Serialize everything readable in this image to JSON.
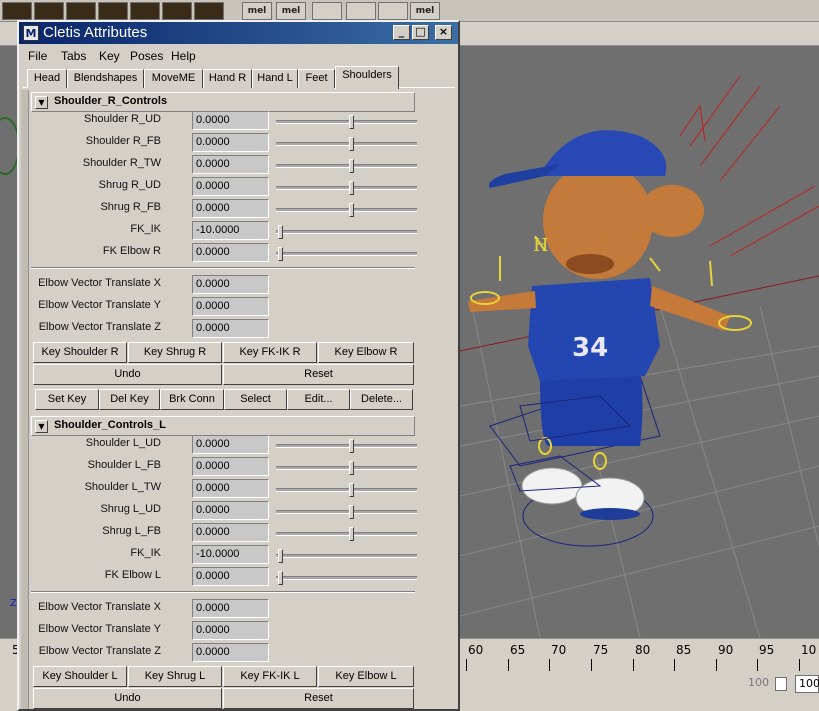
{
  "window": {
    "title": "Cletis Attributes",
    "minimize": "_",
    "maximize": "□",
    "close": "×"
  },
  "menu": [
    "File",
    "Tabs",
    "Key",
    "Poses",
    "Help"
  ],
  "tabs": [
    "Head",
    "Blendshapes",
    "MoveME",
    "Hand R",
    "Hand L",
    "Feet",
    "Shoulders"
  ],
  "active_tab": "Shoulders",
  "sections": {
    "right": {
      "title": "Shoulder_R_Controls",
      "sliders": [
        {
          "label": "Shoulder R_UD",
          "value": "0.0000",
          "pos": 0.5
        },
        {
          "label": "Shoulder R_FB",
          "value": "0.0000",
          "pos": 0.5
        },
        {
          "label": "Shoulder R_TW",
          "value": "0.0000",
          "pos": 0.5
        },
        {
          "label": "Shrug R_UD",
          "value": "0.0000",
          "pos": 0.5
        },
        {
          "label": "Shrug R_FB",
          "value": "0.0000",
          "pos": 0.5
        },
        {
          "label": "FK_IK",
          "value": "-10.0000",
          "pos": 0.0
        },
        {
          "label": "FK Elbow R",
          "value": "0.0000",
          "pos": 0.0
        }
      ],
      "vectors": [
        {
          "label": "Elbow Vector Translate X",
          "value": "0.0000"
        },
        {
          "label": "Elbow Vector Translate Y",
          "value": "0.0000"
        },
        {
          "label": "Elbow Vector Translate Z",
          "value": "0.0000"
        }
      ],
      "key_buttons": [
        "Key Shoulder R",
        "Key Shrug R",
        "Key FK-IK R",
        "Key Elbow R"
      ],
      "undo": "Undo",
      "reset": "Reset"
    },
    "toolbar": [
      "Set Key",
      "Del Key",
      "Brk Conn",
      "Select",
      "Edit...",
      "Delete..."
    ],
    "left": {
      "title": "Shoulder_Controls_L",
      "sliders": [
        {
          "label": "Shoulder L_UD",
          "value": "0.0000",
          "pos": 0.5
        },
        {
          "label": "Shoulder L_FB",
          "value": "0.0000",
          "pos": 0.5
        },
        {
          "label": "Shoulder L_TW",
          "value": "0.0000",
          "pos": 0.5
        },
        {
          "label": "Shrug L_UD",
          "value": "0.0000",
          "pos": 0.5
        },
        {
          "label": "Shrug L_FB",
          "value": "0.0000",
          "pos": 0.5
        },
        {
          "label": "FK_IK",
          "value": "-10.0000",
          "pos": 0.0
        },
        {
          "label": "FK Elbow L",
          "value": "0.0000",
          "pos": 0.0
        }
      ],
      "vectors": [
        {
          "label": "Elbow Vector Translate X",
          "value": "0.0000"
        },
        {
          "label": "Elbow Vector Translate Y",
          "value": "0.0000"
        },
        {
          "label": "Elbow Vector Translate Z",
          "value": "0.0000"
        }
      ],
      "key_buttons": [
        "Key Shoulder L",
        "Key Shrug L",
        "Key FK-IK L",
        "Key Elbow L"
      ],
      "undo": "Undo",
      "reset": "Reset"
    }
  },
  "background": {
    "timeline_ticks": [
      "5",
      "60",
      "65",
      "70",
      "75",
      "80",
      "85",
      "90",
      "95",
      "10"
    ],
    "range_end": "100",
    "range_end2": "100.",
    "jersey_number": "34",
    "shelf_labels": [
      "mel",
      "mel",
      "mel"
    ]
  }
}
